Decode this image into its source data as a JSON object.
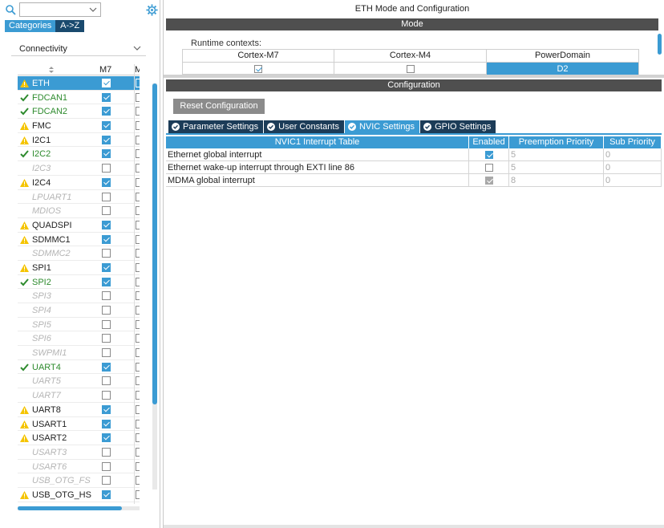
{
  "search": {
    "value": "",
    "placeholder": ""
  },
  "view_tabs": {
    "categories": "Categories",
    "az": "A->Z"
  },
  "category": {
    "selected": "Connectivity"
  },
  "ip_table": {
    "col_m7": "M7",
    "col_m4": "M",
    "items": [
      {
        "label": "ETH",
        "status": "warn",
        "m7": true,
        "selected": true
      },
      {
        "label": "FDCAN1",
        "status": "ok",
        "m7": true
      },
      {
        "label": "FDCAN2",
        "status": "ok",
        "m7": true
      },
      {
        "label": "FMC",
        "status": "warn",
        "m7": true
      },
      {
        "label": "I2C1",
        "status": "warn",
        "m7": true
      },
      {
        "label": "I2C2",
        "status": "ok",
        "m7": true
      },
      {
        "label": "I2C3",
        "status": "disabled",
        "m7": false
      },
      {
        "label": "I2C4",
        "status": "warn",
        "m7": true
      },
      {
        "label": "LPUART1",
        "status": "disabled",
        "m7": false
      },
      {
        "label": "MDIOS",
        "status": "disabled",
        "m7": false
      },
      {
        "label": "QUADSPI",
        "status": "warn",
        "m7": true
      },
      {
        "label": "SDMMC1",
        "status": "warn",
        "m7": true
      },
      {
        "label": "SDMMC2",
        "status": "disabled",
        "m7": false
      },
      {
        "label": "SPI1",
        "status": "warn",
        "m7": true
      },
      {
        "label": "SPI2",
        "status": "ok",
        "m7": true
      },
      {
        "label": "SPI3",
        "status": "disabled",
        "m7": false
      },
      {
        "label": "SPI4",
        "status": "disabled",
        "m7": false
      },
      {
        "label": "SPI5",
        "status": "disabled",
        "m7": false
      },
      {
        "label": "SPI6",
        "status": "disabled",
        "m7": false
      },
      {
        "label": "SWPMI1",
        "status": "disabled",
        "m7": false
      },
      {
        "label": "UART4",
        "status": "ok",
        "m7": true
      },
      {
        "label": "UART5",
        "status": "disabled",
        "m7": false
      },
      {
        "label": "UART7",
        "status": "disabled",
        "m7": false
      },
      {
        "label": "UART8",
        "status": "warn",
        "m7": true
      },
      {
        "label": "USART1",
        "status": "warn",
        "m7": true
      },
      {
        "label": "USART2",
        "status": "warn",
        "m7": true
      },
      {
        "label": "USART3",
        "status": "disabled",
        "m7": false
      },
      {
        "label": "USART6",
        "status": "disabled",
        "m7": false
      },
      {
        "label": "USB_OTG_FS",
        "status": "disabled",
        "m7": false
      },
      {
        "label": "USB_OTG_HS",
        "status": "warn",
        "m7": true
      }
    ]
  },
  "panel": {
    "title": "ETH Mode and Configuration",
    "mode_header": "Mode",
    "config_header": "Configuration"
  },
  "runtime": {
    "label": "Runtime contexts:",
    "columns": [
      {
        "name": "Cortex-M7",
        "checked": true
      },
      {
        "name": "Cortex-M4",
        "checked": false
      },
      {
        "name": "PowerDomain",
        "value": "D2"
      }
    ]
  },
  "config": {
    "reset_label": "Reset Configuration",
    "tabs": [
      {
        "label": "Parameter Settings",
        "active": false
      },
      {
        "label": "User Constants",
        "active": false
      },
      {
        "label": "NVIC Settings",
        "active": true
      },
      {
        "label": "GPIO Settings",
        "active": false
      }
    ]
  },
  "nvic": {
    "headers": [
      "NVIC1 Interrupt Table",
      "Enabled",
      "Preemption Priority",
      "Sub Priority"
    ],
    "rows": [
      {
        "name": "Ethernet global interrupt",
        "enabled": "on",
        "preempt": "5",
        "sub": "0"
      },
      {
        "name": "Ethernet wake-up interrupt through EXTI line 86",
        "enabled": "off",
        "preempt": "5",
        "sub": "0"
      },
      {
        "name": "MDMA global interrupt",
        "enabled": "locked",
        "preempt": "8",
        "sub": "0"
      }
    ]
  },
  "colors": {
    "accent": "#3b9bd3",
    "dark_tab": "#1c3c58",
    "header_bar": "#4f4f4f",
    "ok": "#2e8b2e",
    "warn": "#f5c400"
  }
}
